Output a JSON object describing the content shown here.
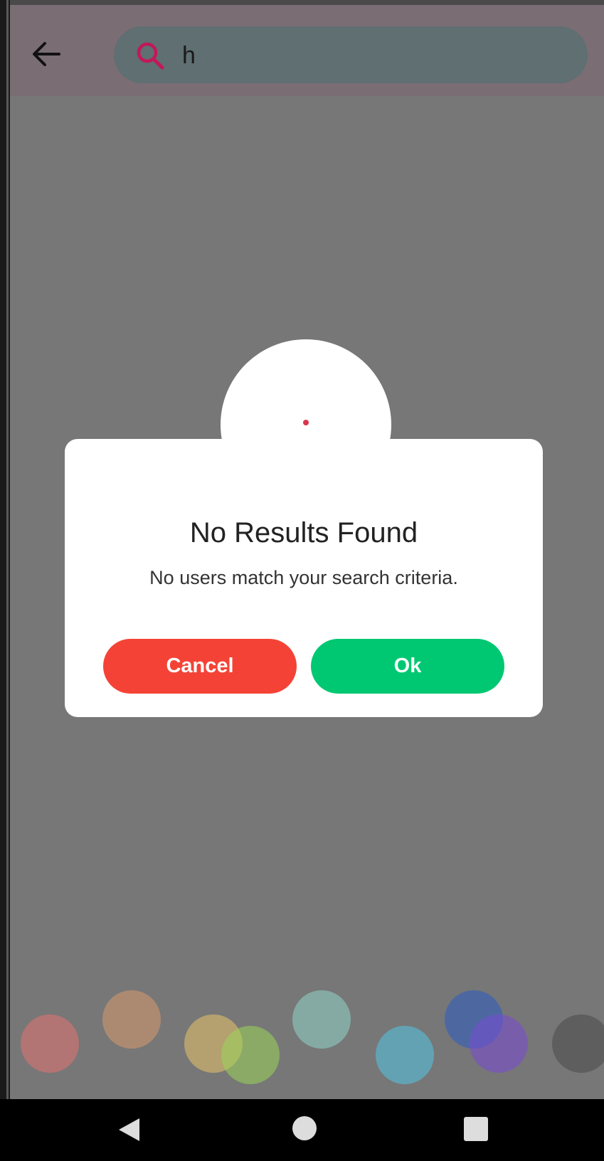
{
  "header": {
    "back_icon": "arrow-left-icon",
    "search_icon": "search-icon",
    "search_value": "h"
  },
  "dialog": {
    "header_dot_color": "#d9364c",
    "title": "No Results Found",
    "message": "No users match your search criteria.",
    "cancel_label": "Cancel",
    "ok_label": "Ok",
    "cancel_color": "#f44336",
    "ok_color": "#00c872"
  },
  "decor": {
    "bubble_colors": [
      "#e57373",
      "#d99a70",
      "#e8c46a",
      "#9ad65a",
      "#8fd6c8",
      "#53c6e6",
      "#2b5cc4",
      "#7a4ad6",
      "#4a4a4a"
    ]
  },
  "navbar": {
    "back_icon": "nav-back-icon",
    "home_icon": "nav-home-icon",
    "recents_icon": "nav-recents-icon"
  }
}
